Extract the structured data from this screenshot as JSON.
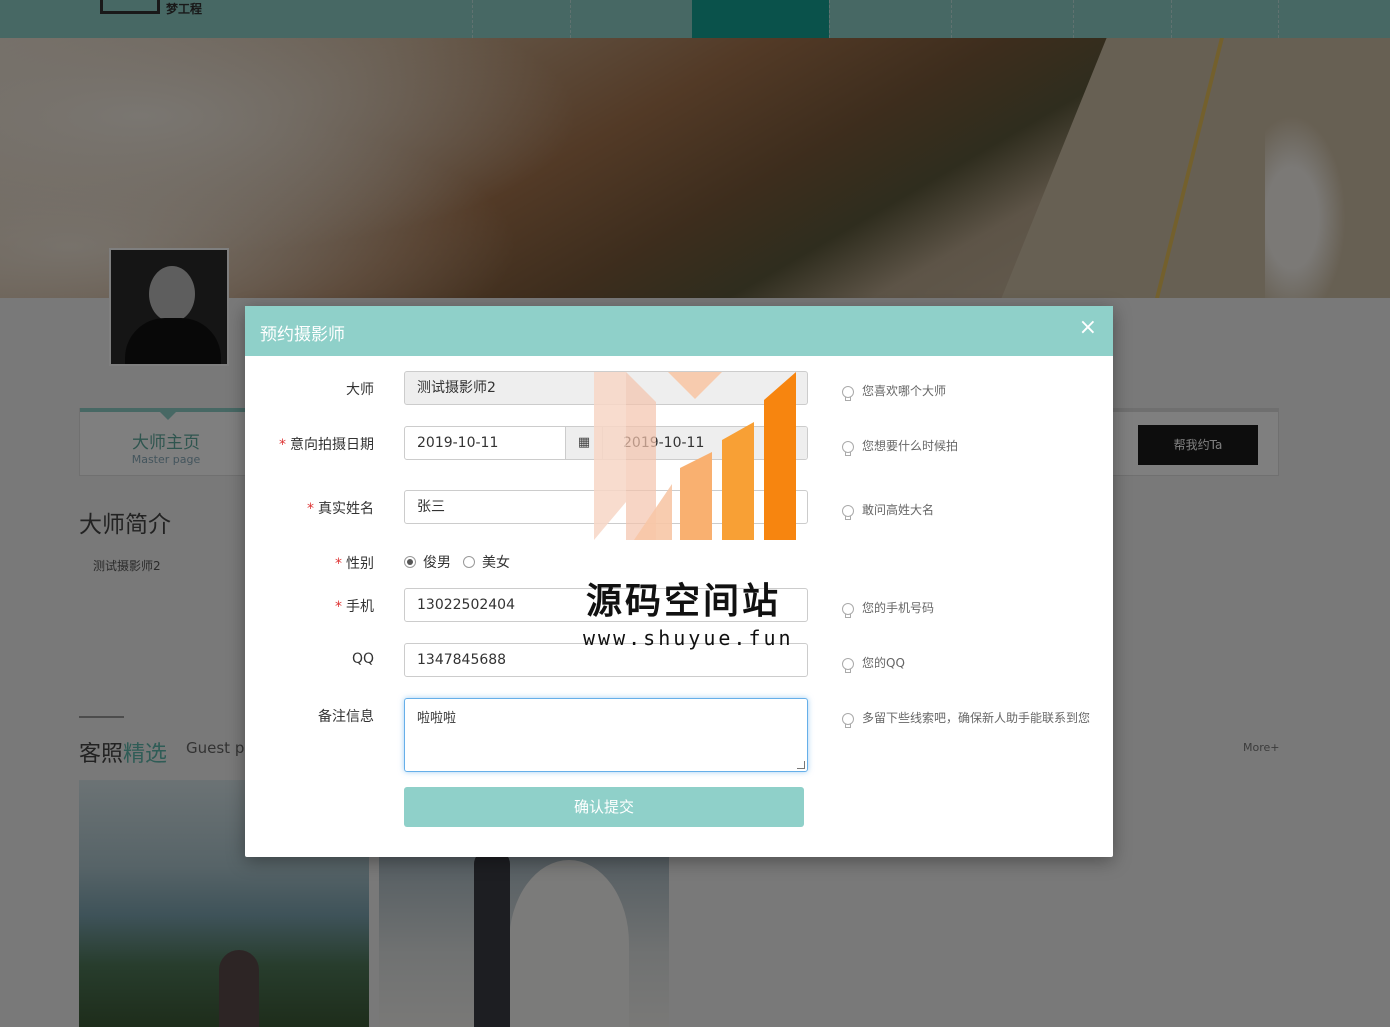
{
  "site": {
    "logo_text": "梦工程"
  },
  "profile": {
    "tab_cn": "大师主页",
    "tab_en": "Master page",
    "book_button": "帮我约Ta",
    "intro_title": "大师简介",
    "intro_text": "测试摄影师2"
  },
  "guest": {
    "title_main": "客照",
    "title_accent": "精选",
    "title_en": "Guest pl",
    "more": "More+"
  },
  "modal": {
    "title": "预约摄影师",
    "close": "×",
    "labels": {
      "master": "大师",
      "date": "意向拍摄日期",
      "name": "真实姓名",
      "gender": "性别",
      "phone": "手机",
      "qq": "QQ",
      "note": "备注信息"
    },
    "required_mark": "*",
    "values": {
      "master": "测试摄影师2",
      "date_start": "2019-10-11",
      "date_end": "2019-10-11",
      "name": "张三",
      "phone": "13022502404",
      "qq": "1347845688",
      "note": "啦啦啦"
    },
    "gender_options": [
      "俊男",
      "美女"
    ],
    "gender_selected": "俊男",
    "hints": {
      "master": "您喜欢哪个大师",
      "date": "您想要什么时候拍",
      "name": "敢问高姓大名",
      "phone": "您的手机号码",
      "qq": "您的QQ",
      "note": "多留下些线索吧，确保新人助手能联系到您"
    },
    "submit": "确认提交",
    "date_icon": "calendar-icon"
  },
  "watermark": {
    "cn": "源码空间站",
    "url": "www.shuyue.fun"
  },
  "colors": {
    "accent": "#8fd0c9",
    "accent_dark": "#14a597",
    "required": "#dd3333",
    "focus": "#66afe9",
    "watermark_orange": "#f7850f"
  }
}
